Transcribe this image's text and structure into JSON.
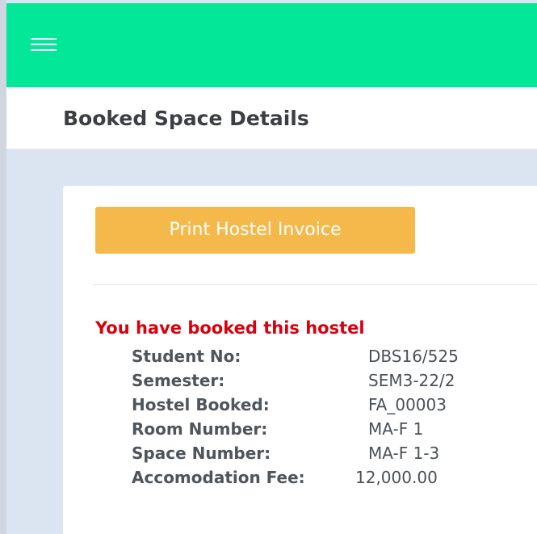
{
  "header": {
    "accent_color": "#03e898",
    "menu_icon": "hamburger-menu-icon"
  },
  "page": {
    "title": "Booked Space Details"
  },
  "actions": {
    "print_label": "Print Hostel Invoice",
    "print_color": "#f5b94b"
  },
  "booking": {
    "heading": "You have booked this hostel",
    "heading_color": "#d9000d",
    "rows": [
      {
        "label": "Student No:",
        "value": "DBS16/525"
      },
      {
        "label": "Semester:",
        "value": "SEM3-22/2"
      },
      {
        "label": "Hostel Booked:",
        "value": "FA_00003"
      },
      {
        "label": "Room Number:",
        "value": "MA-F 1"
      },
      {
        "label": "Space Number:",
        "value": "MA-F 1-3"
      },
      {
        "label": "Accomodation Fee:",
        "value": "12,000.00"
      }
    ]
  }
}
